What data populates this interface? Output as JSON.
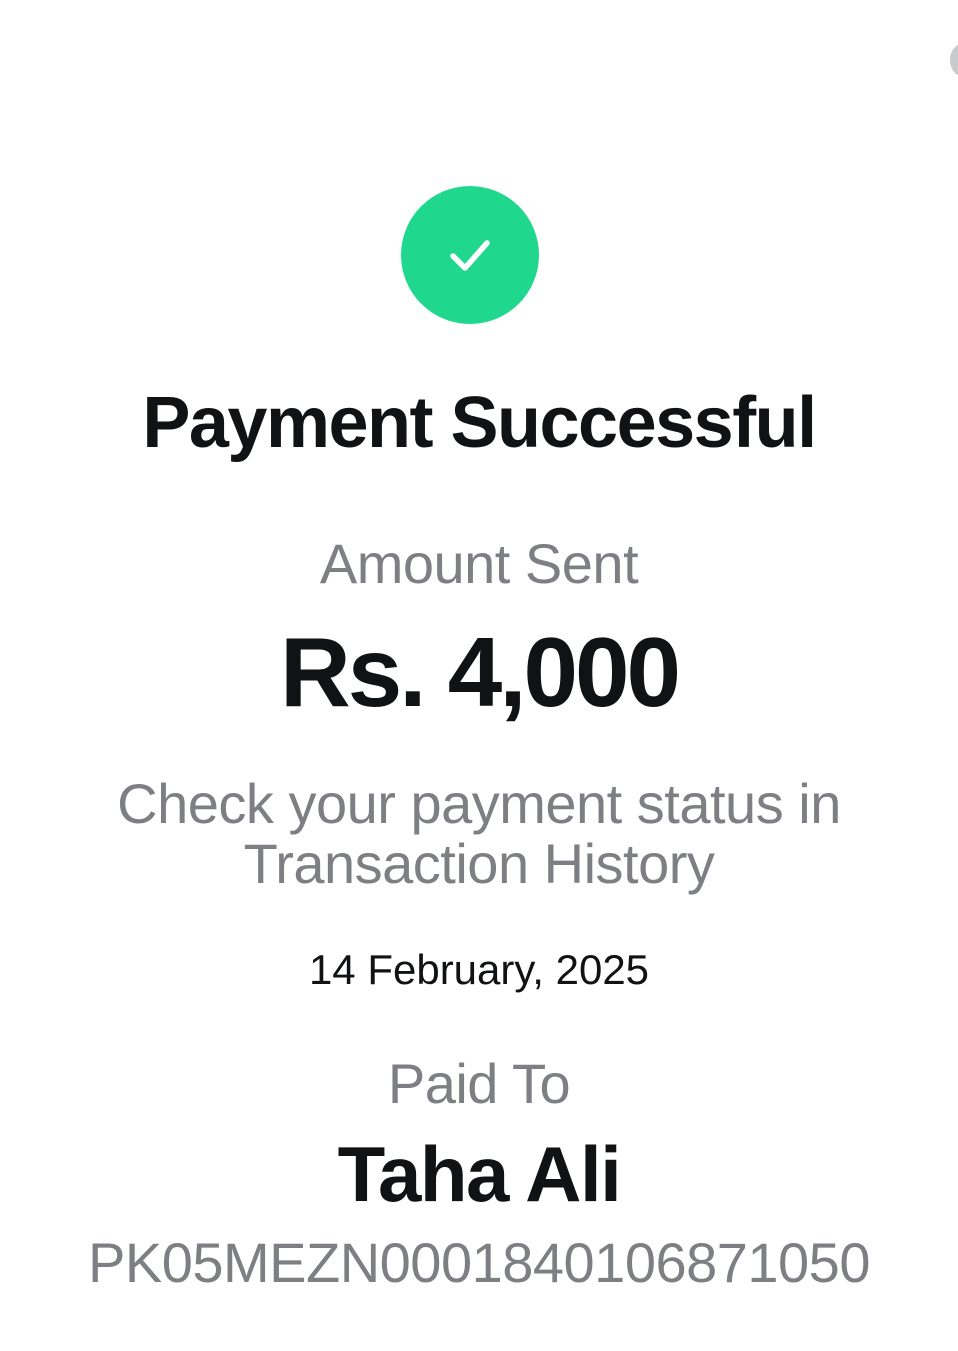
{
  "status": {
    "icon": "check-icon",
    "icon_color": "#1fd88e",
    "title": "Payment Successful"
  },
  "amount": {
    "label": "Amount Sent",
    "value": "Rs. 4,000"
  },
  "message": {
    "line1": "Check your payment status in",
    "line2": "Transaction History"
  },
  "date": "14 February, 2025",
  "recipient": {
    "label": "Paid To",
    "name": "Taha Ali",
    "account": "PK05MEZN0001840106871050"
  }
}
